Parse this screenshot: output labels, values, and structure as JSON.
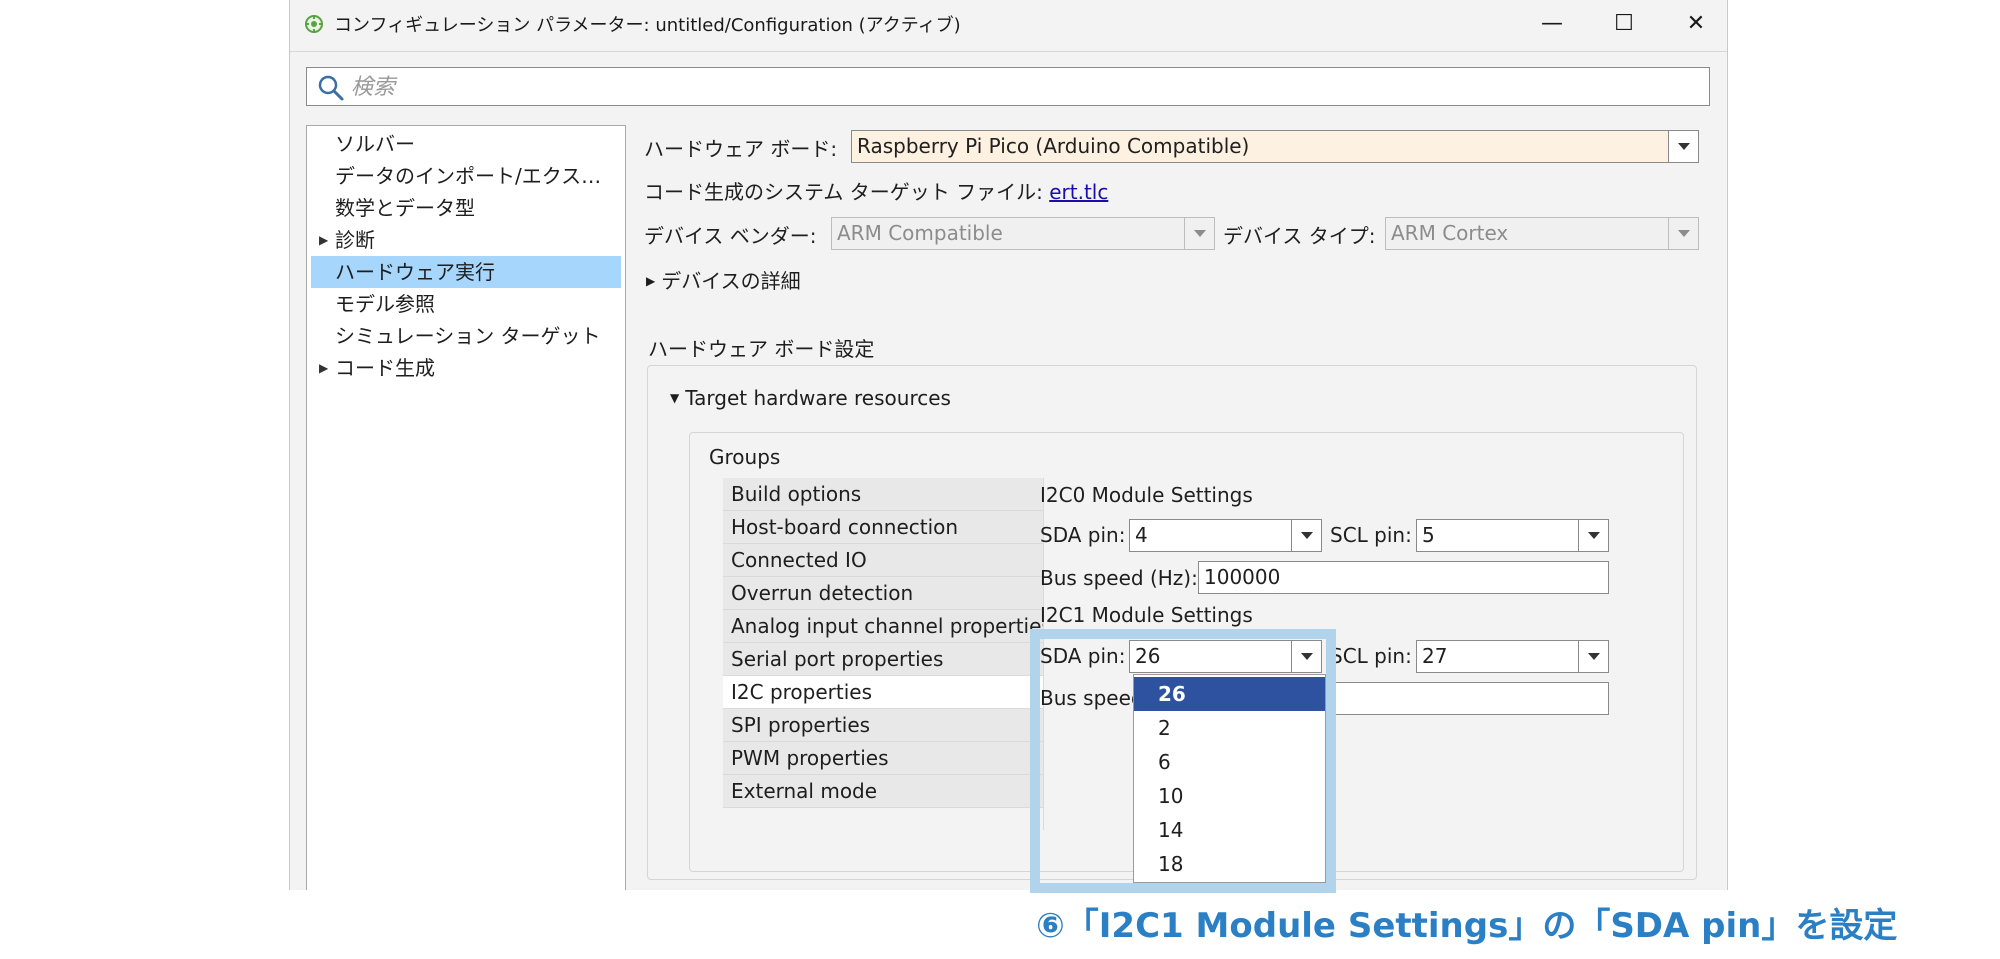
{
  "window": {
    "title": "コンフィギュレーション パラメーター: untitled/Configuration (アクティブ)",
    "minimize_glyph": "—",
    "maximize_glyph": "☐",
    "close_glyph": "✕"
  },
  "search": {
    "placeholder": "検索",
    "value": ""
  },
  "nav": {
    "items": [
      {
        "label": "ソルバー",
        "expandable": false
      },
      {
        "label": "データのインポート/エクス…",
        "expandable": false
      },
      {
        "label": "数学とデータ型",
        "expandable": false
      },
      {
        "label": "診断",
        "expandable": true
      },
      {
        "label": "ハードウェア実行",
        "expandable": false,
        "selected": true
      },
      {
        "label": "モデル参照",
        "expandable": false
      },
      {
        "label": "シミュレーション ターゲット",
        "expandable": false
      },
      {
        "label": "コード生成",
        "expandable": true
      }
    ]
  },
  "main": {
    "board_label": "ハードウェア ボード:",
    "board_value": "Raspberry Pi Pico (Arduino Compatible)",
    "target_file_label": "コード生成のシステム ターゲット ファイル:",
    "target_file_link": "ert.tlc",
    "vendor_label": "デバイス ベンダー:",
    "vendor_value": "ARM Compatible",
    "device_type_label": "デバイス タイプ:",
    "device_type_value": "ARM Cortex",
    "device_details": "デバイスの詳細",
    "board_settings_title": "ハードウェア ボード設定",
    "target_resources": "Target hardware resources",
    "groups_label": "Groups"
  },
  "groups": [
    "Build options",
    "Host-board connection",
    "Connected IO",
    "Overrun detection",
    "Analog input channel properties",
    "Serial port properties",
    "I2C properties",
    "SPI properties",
    "PWM properties",
    "External mode"
  ],
  "active_group": "I2C properties",
  "i2c": {
    "i2c0_title": "I2C0 Module Settings",
    "i2c1_title": "I2C1 Module Settings",
    "sda_label": "SDA pin:",
    "scl_label": "SCL pin:",
    "bus_speed_label": "Bus speed (Hz):",
    "bus_speed_label_partial": "Bus speed",
    "i2c0_sda": "4",
    "i2c0_scl": "5",
    "i2c0_bus_speed": "100000",
    "i2c1_sda": "26",
    "i2c1_scl": "27"
  },
  "sda_dropdown": {
    "options": [
      "26",
      "2",
      "6",
      "10",
      "14",
      "18"
    ],
    "selected": "26"
  },
  "annotation": {
    "caption": "⑥「I2C1 Module Settings」の「SDA pin」を設定",
    "highlight_color": "#b1d3ec",
    "caption_color": "#2b7fc4"
  },
  "colors": {
    "selection": "#a6d6fb",
    "dropdown_selected": "#2f52a0",
    "board_field": "#fdf1e1"
  }
}
